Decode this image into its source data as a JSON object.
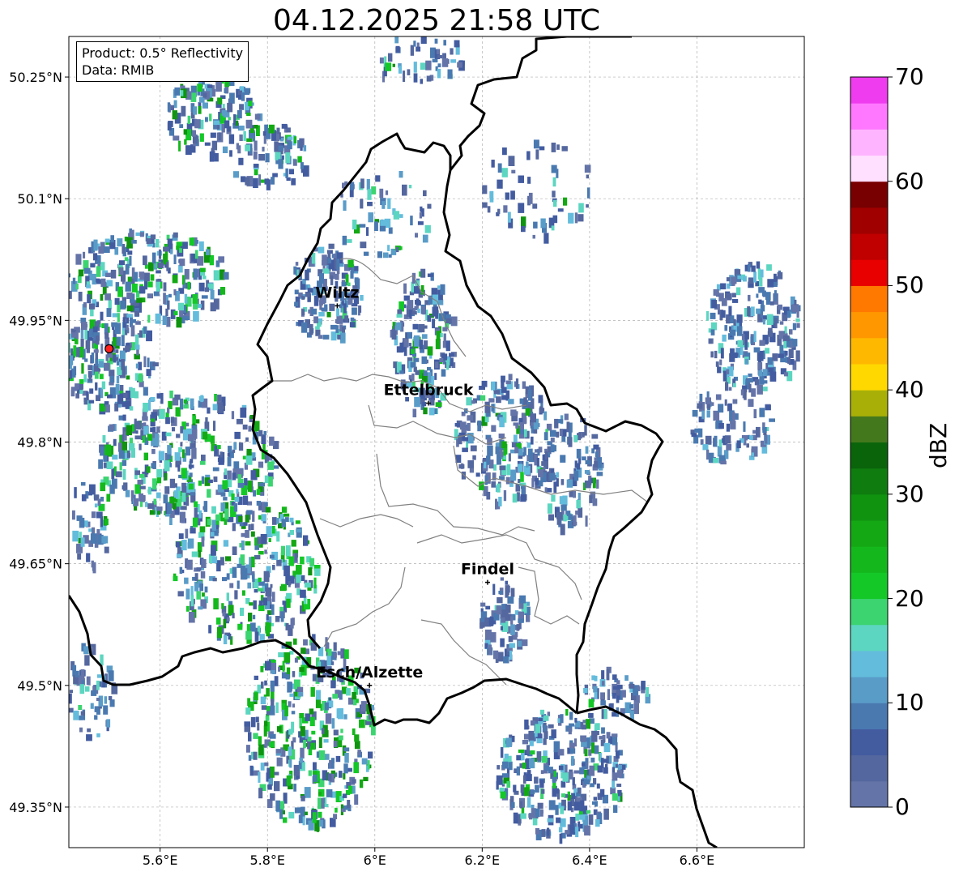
{
  "title": "04.12.2025 21:58 UTC",
  "info": {
    "product": "Product: 0.5° Reflectivity",
    "data": "Data: RMIB"
  },
  "map": {
    "lon_range": [
      5.43,
      6.8
    ],
    "lat_range": [
      49.3,
      50.3
    ],
    "lon_ticks": [
      {
        "value": 5.6,
        "label": "5.6°E"
      },
      {
        "value": 5.8,
        "label": "5.8°E"
      },
      {
        "value": 6.0,
        "label": "6°E"
      },
      {
        "value": 6.2,
        "label": "6.2°E"
      },
      {
        "value": 6.4,
        "label": "6.4°E"
      },
      {
        "value": 6.6,
        "label": "6.6°E"
      }
    ],
    "lat_ticks": [
      {
        "value": 50.25,
        "label": "50.25°N"
      },
      {
        "value": 50.1,
        "label": "50.1°N"
      },
      {
        "value": 49.95,
        "label": "49.95°N"
      },
      {
        "value": 49.8,
        "label": "49.8°N"
      },
      {
        "value": 49.65,
        "label": "49.65°N"
      },
      {
        "value": 49.5,
        "label": "49.5°N"
      },
      {
        "value": 49.35,
        "label": "49.35°N"
      }
    ],
    "cities": [
      {
        "name": "Wiltz",
        "lon": 5.93,
        "lat": 49.968
      },
      {
        "name": "Ettelbruck",
        "lon": 6.1,
        "lat": 49.848
      },
      {
        "name": "Findel",
        "lon": 6.21,
        "lat": 49.627
      },
      {
        "name": "Esch/Alzette",
        "lon": 5.99,
        "lat": 49.5
      }
    ],
    "radar_site": {
      "lon": 5.505,
      "lat": 49.915
    }
  },
  "colorbar": {
    "label": "dBZ",
    "min": 0,
    "max": 70,
    "ticks": [
      0,
      10,
      20,
      30,
      40,
      50,
      60,
      70
    ],
    "colors": [
      "#6474a8",
      "#54679e",
      "#435ca0",
      "#4a79b0",
      "#5a9cc8",
      "#64bcdc",
      "#5cd6c0",
      "#3cd470",
      "#14c828",
      "#14b81c",
      "#14a814",
      "#109410",
      "#0e7c0e",
      "#0a640a",
      "#44781c",
      "#a8b008",
      "#ffd800",
      "#ffb800",
      "#ff9800",
      "#ff7800",
      "#e80000",
      "#c00000",
      "#a00000",
      "#780000",
      "#ffe0ff",
      "#ffb4ff",
      "#ff78ff",
      "#ee3cee"
    ]
  }
}
